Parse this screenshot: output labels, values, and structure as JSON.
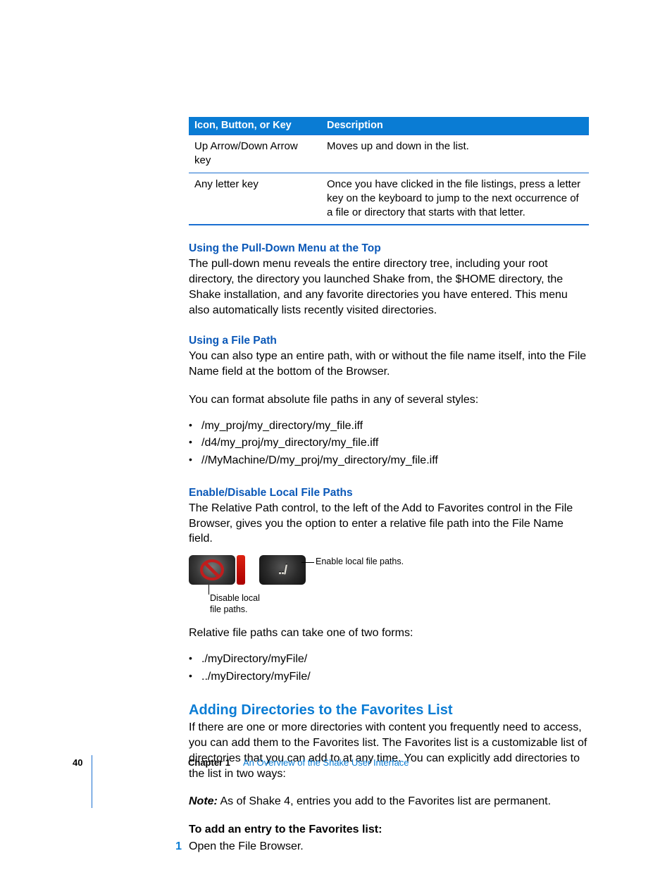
{
  "table": {
    "headers": [
      "Icon, Button, or Key",
      "Description"
    ],
    "rows": [
      {
        "c1": "Up Arrow/Down Arrow key",
        "c2": "Moves up and down in the list."
      },
      {
        "c1": "Any letter key",
        "c2": "Once you have clicked in the file listings, press a letter key on the keyboard to jump to the next occurrence of a file or directory that starts with that letter."
      }
    ]
  },
  "sec1": {
    "h": "Using the Pull-Down Menu at the Top",
    "p": "The pull-down menu reveals the entire directory tree, including your root directory, the directory you launched Shake from, the $HOME directory, the Shake installation, and any favorite directories you have entered. This menu also automatically lists recently visited directories."
  },
  "sec2": {
    "h": "Using a File Path",
    "p1": "You can also type an entire path, with or without the file name itself, into the File Name field at the bottom of the Browser.",
    "p2": "You can format absolute file paths in any of several styles:",
    "items": [
      "/my_proj/my_directory/my_file.iff",
      "/d4/my_proj/my_directory/my_file.iff",
      "//MyMachine/D/my_proj/my_directory/my_file.iff"
    ]
  },
  "sec3": {
    "h": "Enable/Disable Local File Paths",
    "p": "The Relative Path control, to the left of the Add to Favorites control in the File Browser, gives you the option to enter a relative file path into the File Name field.",
    "callout_disable": "Disable local file paths.",
    "callout_enable": "Enable local file paths.",
    "enable_glyph": "../",
    "p2": "Relative file paths can take one of two forms:",
    "items": [
      "./myDirectory/myFile/",
      "../myDirectory/myFile/"
    ]
  },
  "sec4": {
    "h": "Adding Directories to the Favorites List",
    "p": "If there are one or more directories with content you frequently need to access, you can add them to the Favorites list. The Favorites list is a customizable list of directories that you can add to at any time. You can explicitly add directories to the list in two ways:",
    "note_label": "Note:",
    "note": "  As of Shake 4, entries you add to the Favorites list are permanent.",
    "task": "To add an entry to the Favorites list:",
    "step_num": "1",
    "step": "Open the File Browser."
  },
  "footer": {
    "page": "40",
    "chapter": "Chapter 1",
    "title": "An Overview of the Shake User Interface"
  }
}
